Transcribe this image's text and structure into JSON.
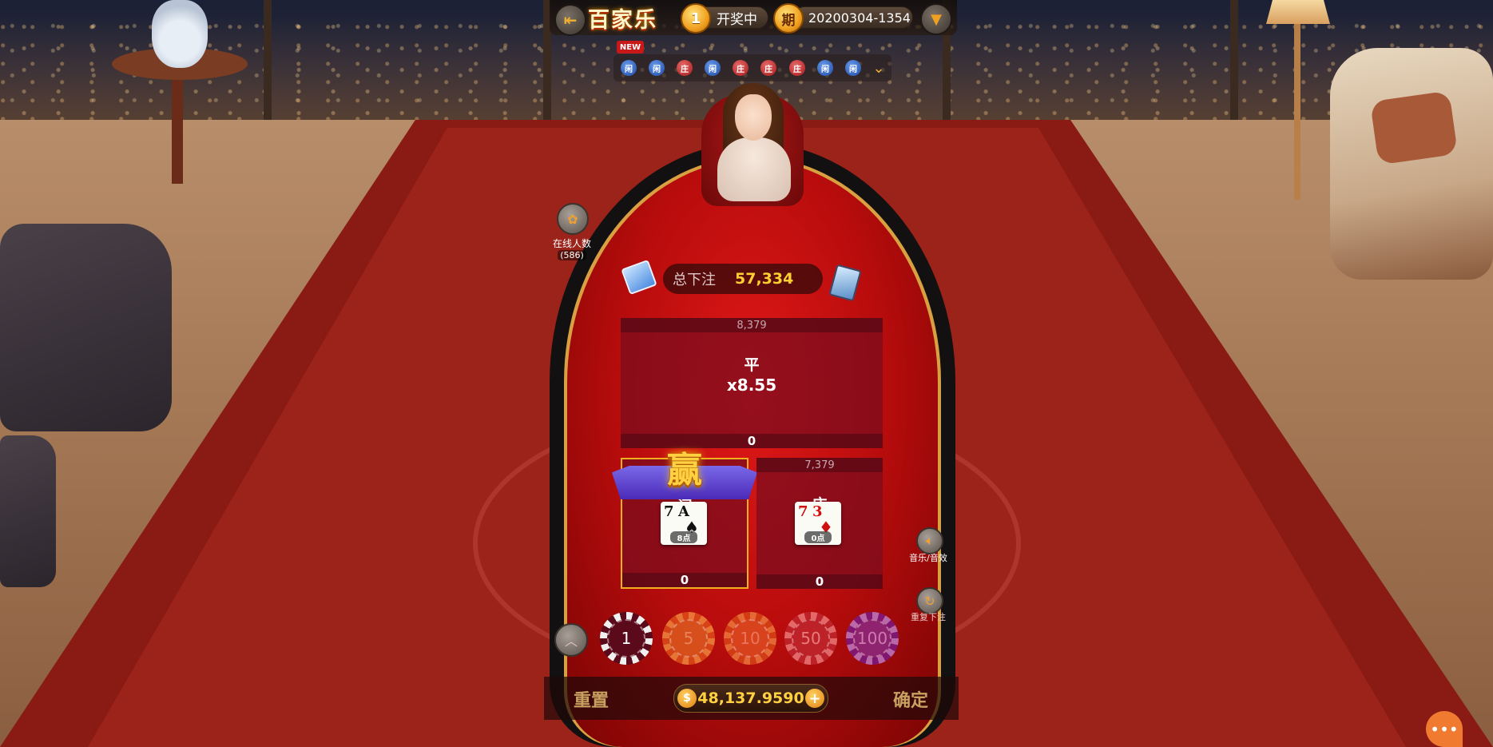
{
  "topbar": {
    "game_title": "百家乐",
    "countdown": "1",
    "status": "开奖中",
    "period_icon": "期",
    "period": "20200304-1354"
  },
  "road": {
    "new_badge": "NEW",
    "results": [
      "闲",
      "闲",
      "庄",
      "闲",
      "庄",
      "庄",
      "庄",
      "闲",
      "闲"
    ]
  },
  "online": {
    "label": "在线人数",
    "count": "(586)"
  },
  "total_bet": {
    "label": "总下注",
    "value": "57,334"
  },
  "tie": {
    "total": "8,379",
    "name": "平",
    "odds": "x8.55",
    "my_bet": "0"
  },
  "player": {
    "total": "",
    "name": "闲",
    "cards": [
      "7",
      "A"
    ],
    "points": "8点",
    "my_bet": "0",
    "win_label": "赢"
  },
  "banker": {
    "total": "7,379",
    "name": "庄",
    "cards": [
      "7",
      "3"
    ],
    "points": "0点",
    "my_bet": "0"
  },
  "side": {
    "sound_label": "音乐/音效",
    "rebet_label": "重复下注"
  },
  "chips": [
    "1",
    "5",
    "10",
    "50",
    "100"
  ],
  "bottom": {
    "reset": "重置",
    "balance": "48,137.9590",
    "confirm": "确定"
  },
  "colors": {
    "felt": "#d01010",
    "gold": "#ffd030",
    "player_road": "#1a4aa8",
    "banker_road": "#a81818"
  },
  "icons": [
    "exit-icon",
    "alarm-clock-icon",
    "period-icon",
    "dropdown-icon",
    "paw-icon",
    "deck-icon",
    "card-shoe-icon",
    "speaker-icon",
    "refresh-icon",
    "chevron-up-icon",
    "dollar-icon",
    "plus-icon",
    "chat-icon"
  ]
}
